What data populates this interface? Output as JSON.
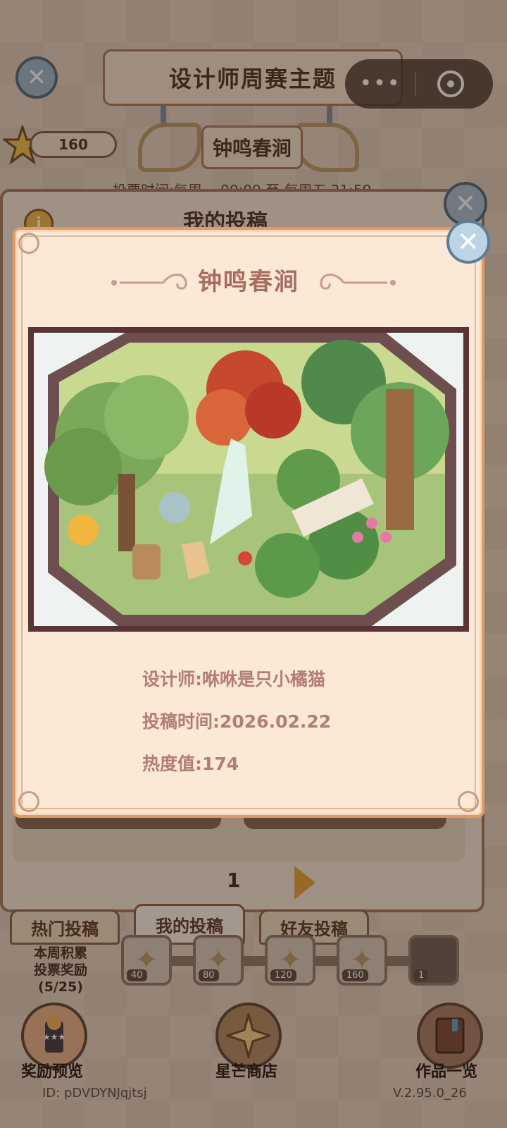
{
  "header": {
    "title": "设计师周赛主题",
    "theme_name": "钟鸣春涧",
    "vote_time": "投票时间:每周一 00:00 至 每周五 21:59",
    "points": "160",
    "capsule_more": "•••"
  },
  "board": {
    "title": "我的投稿",
    "page_number": "1"
  },
  "modal": {
    "title": "钟鸣春涧",
    "designer": "设计师:咻咻是只小橘猫",
    "submit_time": "投稿时间:2026.02.22",
    "heat": "热度值:174"
  },
  "tabs": [
    {
      "label": "热门投稿",
      "active": false
    },
    {
      "label": "我的投稿",
      "active": true
    },
    {
      "label": "好友投稿",
      "active": false
    }
  ],
  "rewards": {
    "label_line1": "本周积累",
    "label_line2": "投票奖励",
    "label_line3": "(5/25)",
    "milestones": [
      "40",
      "80",
      "120",
      "160",
      "1"
    ]
  },
  "bottom_nav": [
    {
      "label": "奖励预览",
      "icon": "trophy-icon"
    },
    {
      "label": "星芒商店",
      "icon": "star-icon"
    },
    {
      "label": "作品一览",
      "icon": "book-icon"
    }
  ],
  "footer": {
    "user_id": "ID: pDVDYNJqjtsj",
    "version": "V.2.95.0_26"
  },
  "colors": {
    "modal_bg": "#fbe8d6",
    "modal_border": "#e39b63",
    "title_text": "#a96c60",
    "detail_text": "#b27d75",
    "artwork_frame": "#5a3434"
  }
}
